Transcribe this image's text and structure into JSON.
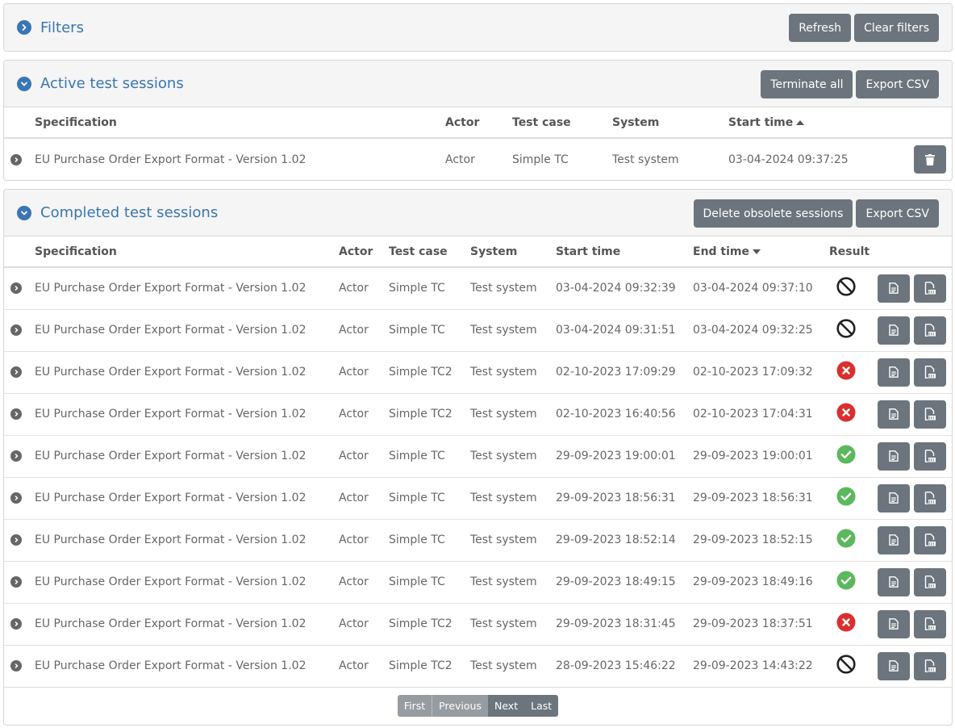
{
  "filters": {
    "title": "Filters",
    "refresh_label": "Refresh",
    "clear_label": "Clear filters"
  },
  "active": {
    "title": "Active test sessions",
    "terminate_label": "Terminate all",
    "export_label": "Export CSV",
    "headers": {
      "specification": "Specification",
      "actor": "Actor",
      "test_case": "Test case",
      "system": "System",
      "start_time": "Start time"
    },
    "rows": [
      {
        "specification": "EU Purchase Order Export Format - Version 1.02",
        "actor": "Actor",
        "test_case": "Simple TC",
        "system": "Test system",
        "start_time": "03-04-2024 09:37:25"
      }
    ]
  },
  "completed": {
    "title": "Completed test sessions",
    "delete_label": "Delete obsolete sessions",
    "export_label": "Export CSV",
    "headers": {
      "specification": "Specification",
      "actor": "Actor",
      "test_case": "Test case",
      "system": "System",
      "start_time": "Start time",
      "end_time": "End time",
      "result": "Result"
    },
    "rows": [
      {
        "specification": "EU Purchase Order Export Format - Version 1.02",
        "actor": "Actor",
        "test_case": "Simple TC",
        "system": "Test system",
        "start_time": "03-04-2024 09:32:39",
        "end_time": "03-04-2024 09:37:10",
        "result": "undefined"
      },
      {
        "specification": "EU Purchase Order Export Format - Version 1.02",
        "actor": "Actor",
        "test_case": "Simple TC",
        "system": "Test system",
        "start_time": "03-04-2024 09:31:51",
        "end_time": "03-04-2024 09:32:25",
        "result": "undefined"
      },
      {
        "specification": "EU Purchase Order Export Format - Version 1.02",
        "actor": "Actor",
        "test_case": "Simple TC2",
        "system": "Test system",
        "start_time": "02-10-2023 17:09:29",
        "end_time": "02-10-2023 17:09:32",
        "result": "failure"
      },
      {
        "specification": "EU Purchase Order Export Format - Version 1.02",
        "actor": "Actor",
        "test_case": "Simple TC2",
        "system": "Test system",
        "start_time": "02-10-2023 16:40:56",
        "end_time": "02-10-2023 17:04:31",
        "result": "failure"
      },
      {
        "specification": "EU Purchase Order Export Format - Version 1.02",
        "actor": "Actor",
        "test_case": "Simple TC",
        "system": "Test system",
        "start_time": "29-09-2023 19:00:01",
        "end_time": "29-09-2023 19:00:01",
        "result": "success"
      },
      {
        "specification": "EU Purchase Order Export Format - Version 1.02",
        "actor": "Actor",
        "test_case": "Simple TC",
        "system": "Test system",
        "start_time": "29-09-2023 18:56:31",
        "end_time": "29-09-2023 18:56:31",
        "result": "success"
      },
      {
        "specification": "EU Purchase Order Export Format - Version 1.02",
        "actor": "Actor",
        "test_case": "Simple TC",
        "system": "Test system",
        "start_time": "29-09-2023 18:52:14",
        "end_time": "29-09-2023 18:52:15",
        "result": "success"
      },
      {
        "specification": "EU Purchase Order Export Format - Version 1.02",
        "actor": "Actor",
        "test_case": "Simple TC",
        "system": "Test system",
        "start_time": "29-09-2023 18:49:15",
        "end_time": "29-09-2023 18:49:16",
        "result": "success"
      },
      {
        "specification": "EU Purchase Order Export Format - Version 1.02",
        "actor": "Actor",
        "test_case": "Simple TC2",
        "system": "Test system",
        "start_time": "29-09-2023 18:31:45",
        "end_time": "29-09-2023 18:37:51",
        "result": "failure"
      },
      {
        "specification": "EU Purchase Order Export Format - Version 1.02",
        "actor": "Actor",
        "test_case": "Simple TC2",
        "system": "Test system",
        "start_time": "28-09-2023 15:46:22",
        "end_time": "29-09-2023 14:43:22",
        "result": "undefined"
      }
    ],
    "pagination": {
      "first": "First",
      "previous": "Previous",
      "next": "Next",
      "last": "Last"
    }
  },
  "colors": {
    "accent": "#3a75b4",
    "button": "#6c757d",
    "success": "#5cb85c",
    "failure": "#d9302f",
    "undefined": "#222222"
  },
  "icons": {
    "panel_toggle": "chevron-circle-icon",
    "row_expand": "chevron-right-circle-icon",
    "delete": "trash-icon",
    "report": "document-icon",
    "pdf": "pdf-icon"
  }
}
